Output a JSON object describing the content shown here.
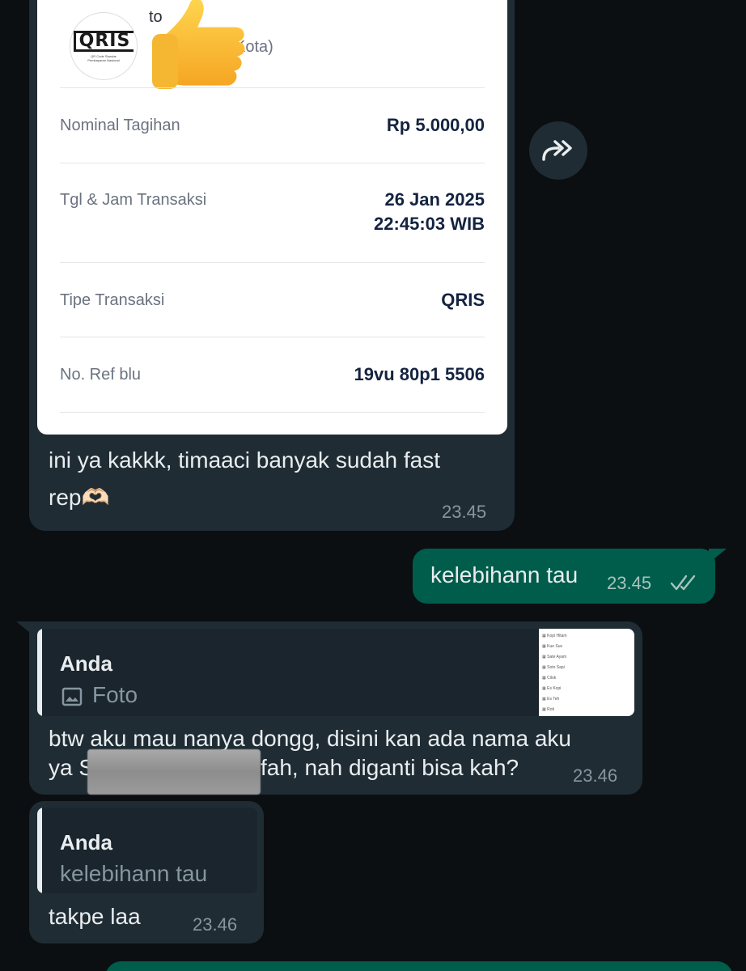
{
  "receipt": {
    "merchant_name": "to",
    "merchant_city": "Kota)",
    "logo_text": "QRIS",
    "logo_subtitle": "QR Code Standar Pembayaran Nasional",
    "rows": [
      {
        "label": "Nominal Tagihan",
        "value": "Rp 5.000,00"
      },
      {
        "label": "Tgl & Jam Transaksi",
        "value": "26 Jan 2025",
        "value2": "22:45:03 WIB"
      },
      {
        "label": "Tipe Transaksi",
        "value": "QRIS"
      },
      {
        "label": "No. Ref blu",
        "value": "19vu 80p1 5506"
      }
    ]
  },
  "messages": {
    "m1": {
      "text_line1": "ini ya kakkk, timaaci banyak sudah fast",
      "text_line2": "rep🫶🏻",
      "time": "23.45"
    },
    "m2": {
      "text": "kelebihann tau",
      "time": "23.45"
    },
    "m3": {
      "quote_author": "Anda",
      "quote_text": "Foto",
      "text_line1": "btw aku mau nanya dongg, disini kan ada nama aku",
      "text_line2a": "ya S",
      "text_line2b": "fah, nah diganti bisa kah?",
      "time": "23.46",
      "thumb_items": [
        "Kopi Hitam",
        "Kue Sus",
        "Sate Ayam",
        "Soto Sapi",
        "Cilok",
        "Es Kopi",
        "Es Teh",
        "Roti"
      ]
    },
    "m4": {
      "quote_author": "Anda",
      "quote_text": "kelebihann tau",
      "text": "takpe laa",
      "time": "23.46"
    }
  },
  "colors": {
    "incoming": "#1f2c34",
    "outgoing": "#005c4b",
    "background": "#0b0f12"
  }
}
